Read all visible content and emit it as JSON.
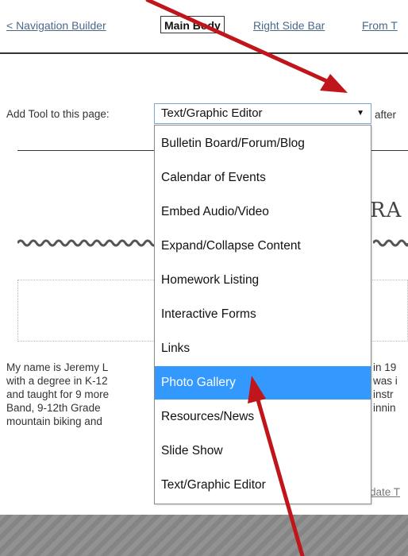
{
  "topnav": {
    "back_link": "< Navigation Builder",
    "active_tab": "Main Body",
    "tab_right_sidebar": "Right Side Bar",
    "tab_from": "From T"
  },
  "tool_row": {
    "label": "Add Tool to this page:",
    "selected_value": "Text/Graphic Editor",
    "caret": "▼",
    "after_label": "after"
  },
  "dropdown": {
    "items": [
      "Bulletin Board/Forum/Blog",
      "Calendar of Events",
      "Embed Audio/Video",
      "Expand/Collapse Content",
      "Homework Listing",
      "Interactive Forms",
      "Links",
      "Photo Gallery",
      "Resources/News",
      "Slide Show",
      "Text/Graphic Editor"
    ],
    "highlighted": "Photo Gallery"
  },
  "page": {
    "heading_fragment": "RA",
    "paragraph_lines": [
      "My name is Jeremy L",
      "with a degree in K-12",
      "and taught for 9 more",
      "Band, 9-12th Grade",
      "mountain biking and"
    ],
    "paragraph_right": [
      "in 19",
      "was i",
      "instr",
      "innin",
      ""
    ],
    "update_link": "date T"
  },
  "colors": {
    "highlight": "#3399ff",
    "annotation_arrow": "#c0161b",
    "footer": "#8a8a8a"
  }
}
